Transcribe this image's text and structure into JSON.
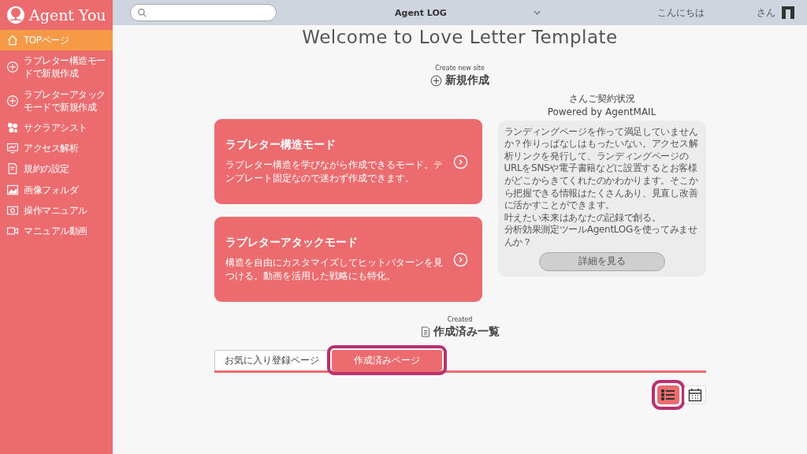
{
  "brand": {
    "name": "Agent You"
  },
  "sidebar": {
    "items": [
      {
        "label": "TOPページ",
        "selected": true
      },
      {
        "label": "ラブレター構造モードで新規作成",
        "selected": false
      },
      {
        "label": "ラブレターアタックモードで新規作成",
        "selected": false
      },
      {
        "label": "サクラアシスト",
        "selected": false
      },
      {
        "label": "アクセス解析",
        "selected": false
      },
      {
        "label": "規約の設定",
        "selected": false
      },
      {
        "label": "画像フォルダ",
        "selected": false
      },
      {
        "label": "操作マニュアル",
        "selected": false
      },
      {
        "label": "マニュアル動画",
        "selected": false
      }
    ]
  },
  "topbar": {
    "app_select": "Agent LOG",
    "greeting": "こんにちは",
    "honorific": "さん"
  },
  "title": "Welcome to Love Letter Template",
  "create": {
    "caption": "Create new site",
    "heading": "新規作成",
    "cards": [
      {
        "title": "ラブレター構造モード",
        "text": "ラブレター構造を学びながら作成できるモード。テンプレート固定なので迷わず作成できます。"
      },
      {
        "title": "ラブレターアタックモード",
        "text": "構造を自由にカスタマイズしてヒットパターンを見つける。動画を活用した戦略にも特化。"
      }
    ]
  },
  "contract": {
    "heading": "さんご契約状況",
    "powered": "Powered by AgentMAIL",
    "paragraphs": [
      "ランディングページを作って満足していませんか？作りっぱなしはもったいない。アクセス解析リンクを発行して、ランディングページのURLをSNSや電子書籍などに設置するとお客様がどこからきてくれたのかわかります。そこから把握できる情報はたくさんあり、見直し改善に活かすことができます。",
      "叶えたい未来はあなたの記録で創る。",
      "分析効果測定ツールAgentLOGを使ってみませんか？"
    ],
    "button": "詳細を見る"
  },
  "created": {
    "caption": "Created",
    "heading": "作成済み一覧",
    "tabs": [
      {
        "label": "お気に入り登録ページ",
        "selected": false,
        "highlighted": false
      },
      {
        "label": "作成済みページ",
        "selected": true,
        "highlighted": true
      }
    ],
    "views": [
      {
        "kind": "list",
        "selected": true,
        "highlighted": true
      },
      {
        "kind": "calendar",
        "selected": false,
        "highlighted": false
      }
    ]
  }
}
